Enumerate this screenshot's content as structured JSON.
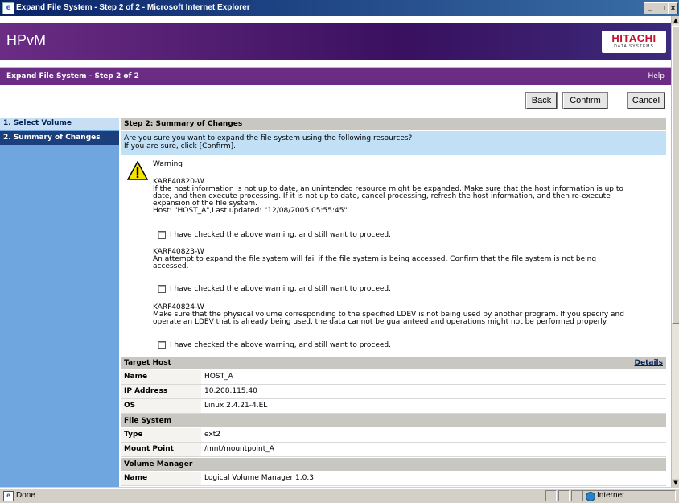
{
  "window": {
    "title": "Expand File System - Step 2 of 2 - Microsoft Internet Explorer",
    "min_icon": "minimize-icon",
    "max_icon": "maximize-icon",
    "close_icon": "close-icon"
  },
  "banner": {
    "product": "HPvM",
    "logo_line1": "HITACHI",
    "logo_line2": "DATA SYSTEMS"
  },
  "subbar": {
    "page_title": "Expand File System - Step 2 of 2",
    "help": "Help"
  },
  "buttons": {
    "back": "Back",
    "confirm": "Confirm",
    "cancel": "Cancel"
  },
  "sidebar": {
    "items": [
      {
        "label": "1. Select Volume"
      },
      {
        "label": "2. Summary of Changes"
      }
    ]
  },
  "main": {
    "step_heading": "Step 2: Summary of Changes",
    "prompt_line1": "Are you sure you want to expand the file system using the following resources?",
    "prompt_line2": "If you are sure, click [Confirm].",
    "warning_title": "Warning",
    "warnings": [
      {
        "code": "KARF40820-W",
        "lines": [
          "If the host information is not up to date, an unintended resource might be expanded. Make sure that the host information is up to",
          "date, and then execute processing. If it is not up to date, cancel processing, refresh the host information, and then re-execute",
          "expansion of the file system.",
          "Host: \"HOST_A\",Last updated: \"12/08/2005 05:55:45\""
        ]
      },
      {
        "code": "KARF40823-W",
        "lines": [
          "An attempt to expand the file system will fail if the file system is being accessed. Confirm that the file system is not being",
          "accessed."
        ]
      },
      {
        "code": "KARF40824-W",
        "lines": [
          "Make sure that the physical volume corresponding to the specified LDEV is not being used by another program. If you specify and",
          "operate an LDEV that is already being used, the data cannot be guaranteed and operations might not be performed properly."
        ]
      }
    ],
    "checkbox_label": "I have checked the above warning, and still want to proceed.",
    "target_host": {
      "heading": "Target Host",
      "details": "Details",
      "rows": [
        {
          "label": "Name",
          "value": "HOST_A"
        },
        {
          "label": "IP Address",
          "value": "10.208.115.40"
        },
        {
          "label": "OS",
          "value": "Linux 2.4.21-4.EL"
        }
      ]
    },
    "file_system": {
      "heading": "File System",
      "rows": [
        {
          "label": "Type",
          "value": "ext2"
        },
        {
          "label": "Mount Point",
          "value": "/mnt/mountpoint_A"
        }
      ]
    },
    "volume_manager": {
      "heading": "Volume Manager",
      "rows": [
        {
          "label": "Name",
          "value": "Logical Volume Manager  1.0.3"
        }
      ]
    }
  },
  "statusbar": {
    "status": "Done",
    "zone": "Internet"
  }
}
